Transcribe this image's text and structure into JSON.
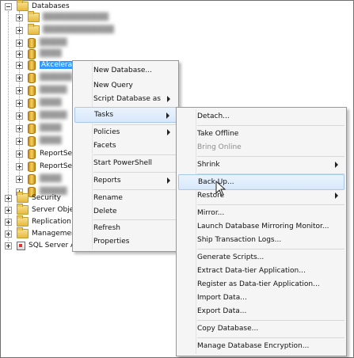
{
  "tree": {
    "root_label": "Databases",
    "db_selected": "Akcelerant",
    "report1": "ReportServ",
    "report2": "ReportServ",
    "security": "Security",
    "server_objects": "Server Objects",
    "replication": "Replication",
    "management": "Management",
    "sql_agent": "SQL Server Ag"
  },
  "context_menu": {
    "items": {
      "new_database": "New Database...",
      "new_query": "New Query",
      "script_database": "Script Database as",
      "tasks": "Tasks",
      "policies": "Policies",
      "facets": "Facets",
      "start_powershell": "Start PowerShell",
      "reports": "Reports",
      "rename": "Rename",
      "delete": "Delete",
      "refresh": "Refresh",
      "properties": "Properties"
    }
  },
  "tasks_menu": {
    "items": {
      "detach": "Detach...",
      "take_offline": "Take Offline",
      "bring_online": "Bring Online",
      "shrink": "Shrink",
      "back_up": "Back Up...",
      "restore": "Restore",
      "mirror": "Mirror...",
      "launch_mirroring": "Launch Database Mirroring Monitor...",
      "ship_logs": "Ship Transaction Logs...",
      "generate_scripts": "Generate Scripts...",
      "extract_dac": "Extract Data-tier Application...",
      "register_dac": "Register as Data-tier Application...",
      "import_data": "Import Data...",
      "export_data": "Export Data...",
      "copy_database": "Copy Database...",
      "manage_encryption": "Manage Database Encryption..."
    }
  },
  "colors": {
    "selection": "#3399ff",
    "highlight_border": "#a8c8ec"
  }
}
